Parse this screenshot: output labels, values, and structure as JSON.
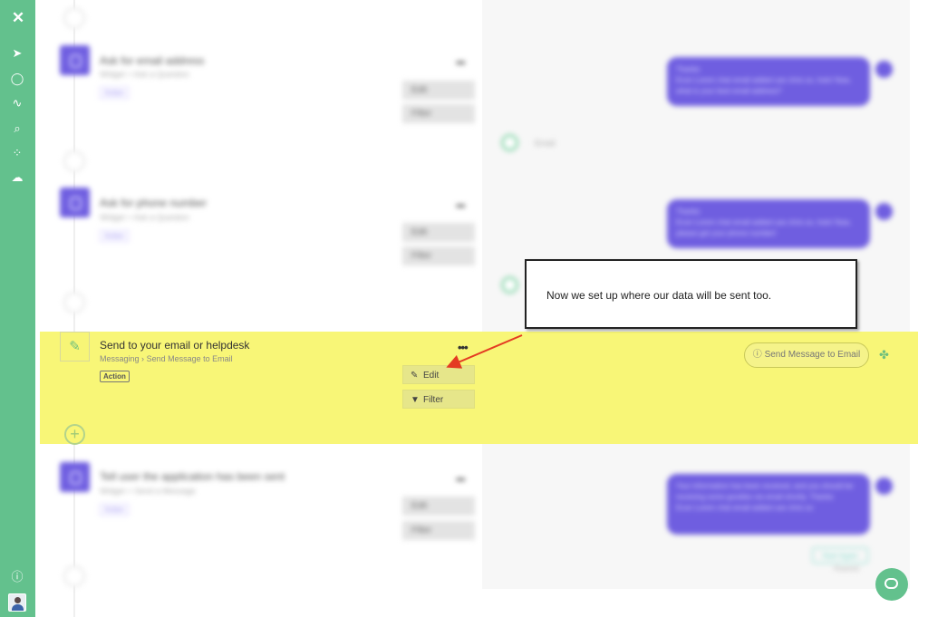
{
  "sidebar": {
    "logo": "✕",
    "icons": [
      "circle-arrow-icon",
      "chat-bubble-icon",
      "activity-icon",
      "search-icon",
      "broadcast-icon",
      "cloud-icon",
      "info-icon",
      "avatar"
    ]
  },
  "workflow": {
    "steps_blurred": [
      {
        "title": "Ask for email address",
        "subtitle": "Widget > Ask a Question",
        "tag": "Action",
        "edit": "Edit",
        "filter": "Filter"
      },
      {
        "title": "Ask for phone number",
        "subtitle": "Widget > Ask a Question",
        "tag": "Action",
        "edit": "Edit",
        "filter": "Filter"
      },
      {
        "title": "Tell user the application has been sent",
        "subtitle": "Widget > Send a Message",
        "tag": "Action",
        "edit": "Edit",
        "filter": "Filter"
      }
    ],
    "highlighted_step": {
      "title": "Send to your email or helpdesk",
      "breadcrumb_part1": "Messaging",
      "breadcrumb_separator": "›",
      "breadcrumb_part2": "Send Message to Email",
      "tag": "Action",
      "more_label": "•••",
      "edit_label": "Edit",
      "filter_label": "Filter"
    }
  },
  "preview": {
    "bubble1": "Thanks\nEcon Lorem chat email added use chris so, holo! Now, what is your best email address?",
    "reply1": "Email",
    "bubble2": "Thanks\nEcon Lorem chat email added use chris so, holo! Now, please get your phone number!",
    "pill_label": "Send Message to Email",
    "bubble3": "Your information has been received, and you should be receiving some goodies via email shortly. Thanks\nEcon Lorem chat email added use chris so",
    "quick_reply": "Start Again",
    "powered": "Powered"
  },
  "callout": {
    "text": "Now we set up where our data will be sent too."
  },
  "colors": {
    "sidebar": "#63c18d",
    "accent_purple": "#6f5ee0",
    "highlight_yellow": "#f8f670",
    "arrow_red": "#e43b22"
  }
}
